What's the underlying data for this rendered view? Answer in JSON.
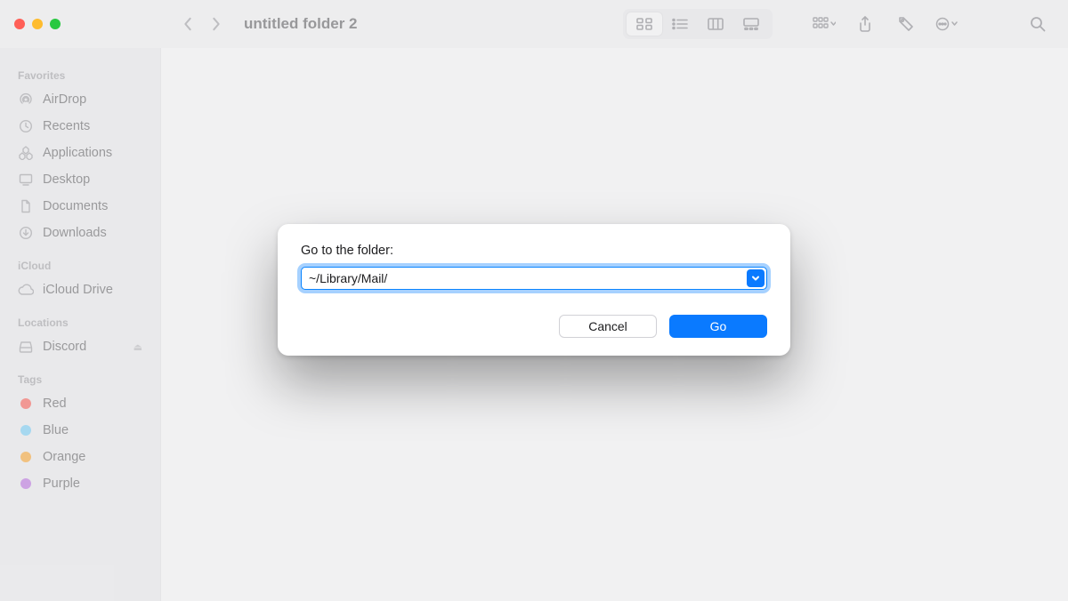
{
  "window": {
    "title": "untitled folder 2"
  },
  "sidebar": {
    "sections": [
      {
        "title": "Favorites",
        "items": [
          {
            "icon": "airdrop-icon",
            "label": "AirDrop"
          },
          {
            "icon": "clock-icon",
            "label": "Recents"
          },
          {
            "icon": "apps-icon",
            "label": "Applications"
          },
          {
            "icon": "desktop-icon",
            "label": "Desktop"
          },
          {
            "icon": "doc-icon",
            "label": "Documents"
          },
          {
            "icon": "download-icon",
            "label": "Downloads"
          }
        ]
      },
      {
        "title": "iCloud",
        "items": [
          {
            "icon": "cloud-icon",
            "label": "iCloud Drive"
          }
        ]
      },
      {
        "title": "Locations",
        "items": [
          {
            "icon": "disk-icon",
            "label": "Discord",
            "eject": true
          }
        ]
      },
      {
        "title": "Tags",
        "items": [
          {
            "tagColor": "#ff3b30",
            "label": "Red"
          },
          {
            "tagColor": "#5ac8fa",
            "label": "Blue"
          },
          {
            "tagColor": "#ff9500",
            "label": "Orange"
          },
          {
            "tagColor": "#af52de",
            "label": "Purple"
          }
        ]
      }
    ]
  },
  "dialog": {
    "label": "Go to the folder:",
    "value": "~/Library/Mail/",
    "cancel": "Cancel",
    "go": "Go"
  }
}
